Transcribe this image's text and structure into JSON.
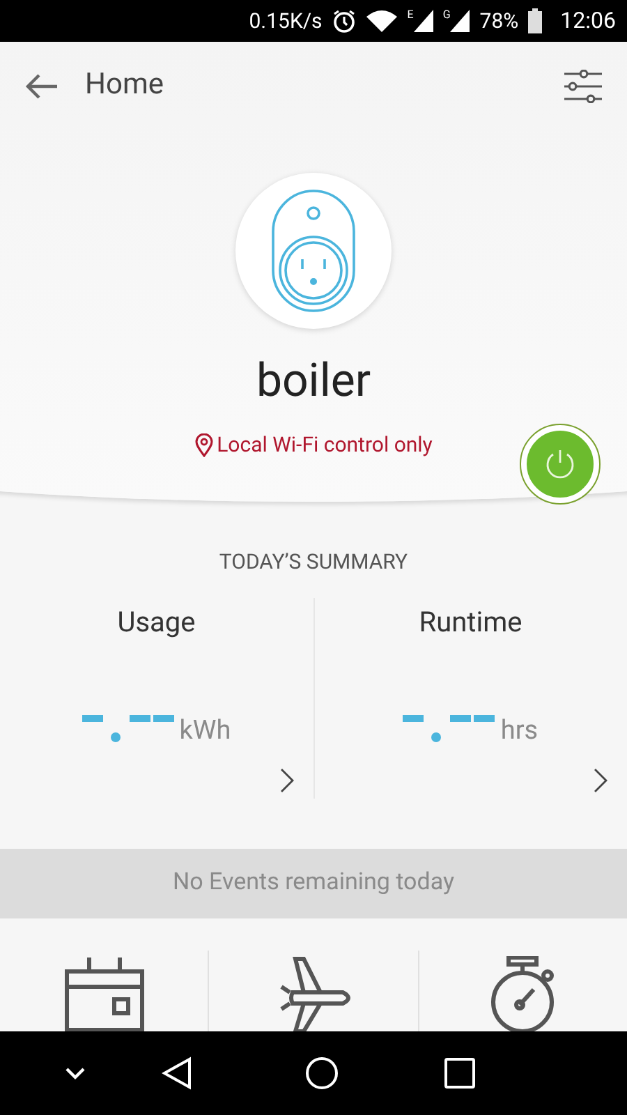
{
  "status_bar": {
    "net_speed": "0.15K/s",
    "signals": [
      "E",
      "G"
    ],
    "battery": "78%",
    "time": "12:06"
  },
  "header": {
    "title": "Home"
  },
  "device": {
    "name": "boiler",
    "note": "Local Wi-Fi control only",
    "on": true
  },
  "summary": {
    "title": "TODAY’S SUMMARY",
    "cards": [
      {
        "label": "Usage",
        "unit": "kWh"
      },
      {
        "label": "Runtime",
        "unit": "hrs"
      }
    ]
  },
  "events_banner": "No Events remaining today",
  "actions": [
    {
      "kind": "schedule"
    },
    {
      "kind": "away"
    },
    {
      "kind": "timer"
    }
  ]
}
